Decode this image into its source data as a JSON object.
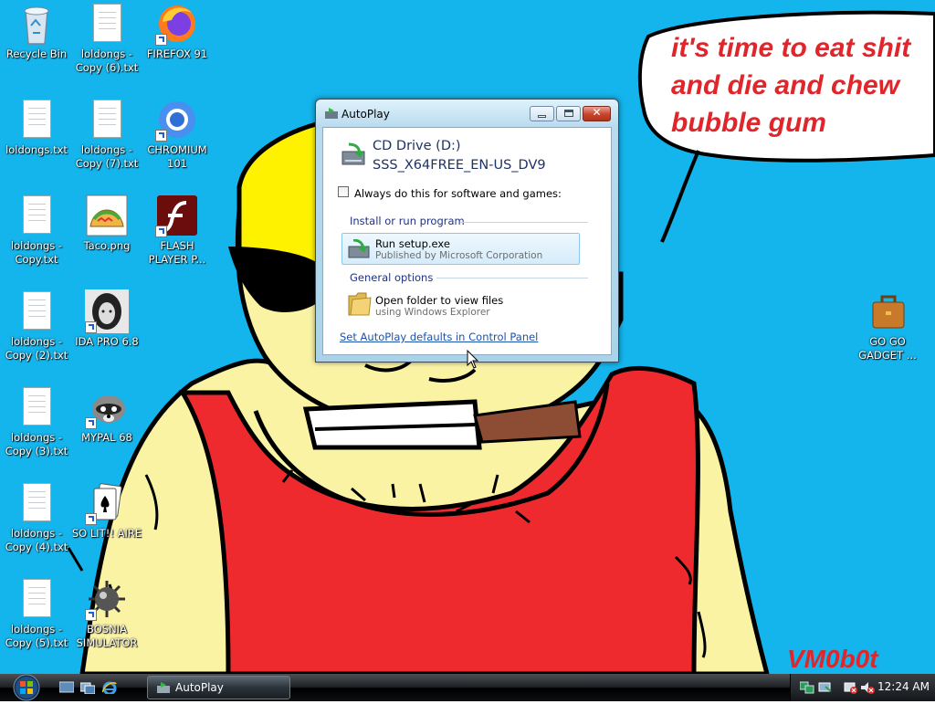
{
  "desktop": {
    "background_color": "#14b4ec",
    "icons": [
      {
        "label": "Recycle Bin",
        "icon": "recycle-bin-icon"
      },
      {
        "label": "loldongs - Copy (6).txt",
        "icon": "text-file-icon"
      },
      {
        "label": "FIREFOX 91",
        "icon": "firefox-icon"
      },
      {
        "label": "loldongs.txt",
        "icon": "text-file-icon"
      },
      {
        "label": "loldongs - Copy (7).txt",
        "icon": "text-file-icon"
      },
      {
        "label": "CHROMIUM 101",
        "icon": "chromium-icon"
      },
      {
        "label": "loldongs - Copy.txt",
        "icon": "text-file-icon"
      },
      {
        "label": "Taco.png",
        "icon": "taco-image-icon"
      },
      {
        "label": "FLASH PLAYER P...",
        "icon": "flash-player-icon"
      },
      {
        "label": "loldongs - Copy (2).txt",
        "icon": "text-file-icon"
      },
      {
        "label": "IDA PRO 6.8",
        "icon": "ida-pro-icon"
      },
      {
        "label": "loldongs - Copy (3).txt",
        "icon": "text-file-icon"
      },
      {
        "label": "MYPAL 68",
        "icon": "mypal-raccoon-icon"
      },
      {
        "label": "loldongs - Copy (4).txt",
        "icon": "text-file-icon"
      },
      {
        "label": "SO LIT!! AIRE",
        "icon": "solitaire-icon"
      },
      {
        "label": "loldongs - Copy (5).txt",
        "icon": "text-file-icon"
      },
      {
        "label": "BOSNIA SIMULATOR",
        "icon": "minesweeper-mine-icon"
      },
      {
        "label": "GO GO GADGET ...",
        "icon": "briefcase-icon"
      }
    ],
    "wallpaper": {
      "speech_lines": [
        "it's time to eat shit",
        "and die and chew",
        "bubble gum"
      ],
      "signature": "VM0b0t"
    }
  },
  "dialog": {
    "title": "AutoPlay",
    "close_glyph": "✕",
    "drive_name": "CD Drive (D:)",
    "drive_label": "SSS_X64FREE_EN-US_DV9",
    "always_label": "Always do this for software and games:",
    "always_checked": false,
    "install_header": "Install or run program",
    "run_label": "Run setup.exe",
    "run_sub": "Published by Microsoft Corporation",
    "general_header": "General options",
    "folder_label": "Open folder to view files",
    "folder_sub": "using Windows Explorer",
    "link": "Set AutoPlay defaults in Control Panel"
  },
  "taskbar": {
    "task_label": "AutoPlay",
    "clock": "12:24 AM"
  }
}
